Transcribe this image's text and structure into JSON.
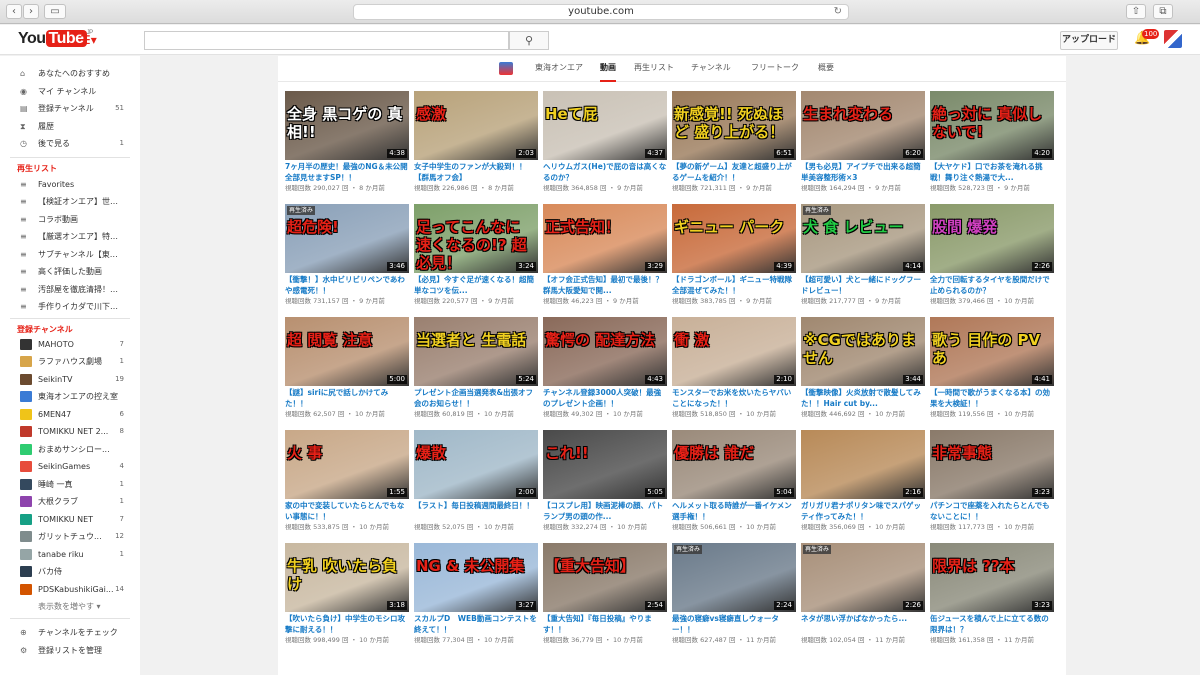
{
  "browser": {
    "url": "youtube.com"
  },
  "masthead": {
    "logo_you": "You",
    "logo_tube": "Tube",
    "logo_region": "JP",
    "upload_label": "アップロード",
    "notification_count": "100"
  },
  "sidebar": {
    "top_items": [
      {
        "icon": "home-icon",
        "label": "あなたへのおすすめ",
        "count": ""
      },
      {
        "icon": "user-icon",
        "label": "マイ チャンネル",
        "count": ""
      },
      {
        "icon": "subscriptions-icon",
        "label": "登録チャンネル",
        "count": "51"
      },
      {
        "icon": "history-icon",
        "label": "履歴",
        "count": ""
      },
      {
        "icon": "clock-icon",
        "label": "後で見る",
        "count": "1"
      }
    ],
    "playlists_heading": "再生リスト",
    "playlists": [
      {
        "label": "Favorites"
      },
      {
        "label": "【検証オンエア】世界..."
      },
      {
        "label": "コラボ動画"
      },
      {
        "label": "【厳選オンエア】特に..."
      },
      {
        "label": "サブチャンネル【東海..."
      },
      {
        "label": "高く評価した動画"
      },
      {
        "label": "汚部屋を徹底清掃！床..."
      },
      {
        "label": "手作りイカダで川下り！"
      }
    ],
    "subs_heading": "登録チャンネル",
    "subscriptions": [
      {
        "label": "MAHOTO",
        "count": "7",
        "color": "#333333"
      },
      {
        "label": "ラファハウス劇場",
        "count": "1",
        "color": "#d7a54a"
      },
      {
        "label": "SeikinTV",
        "count": "19",
        "color": "#6b4a2f"
      },
      {
        "label": "東海オンエアの控え室",
        "count": "",
        "color": "#3a7bd5"
      },
      {
        "label": "6MEN47",
        "count": "6",
        "color": "#f0c419"
      },
      {
        "label": "TOMIKKU NET 2...",
        "count": "8",
        "color": "#c0392b"
      },
      {
        "label": "おまめサンシロー...",
        "count": "",
        "color": "#2ecc71"
      },
      {
        "label": "SeikinGames",
        "count": "4",
        "color": "#e74c3c"
      },
      {
        "label": "睡崎 一真",
        "count": "1",
        "color": "#34495e"
      },
      {
        "label": "大根クラブ",
        "count": "1",
        "color": "#8e44ad"
      },
      {
        "label": "TOMIKKU NET",
        "count": "7",
        "color": "#16a085"
      },
      {
        "label": "ガリットチュウ...",
        "count": "12",
        "color": "#7f8c8d"
      },
      {
        "label": "tanabe riku",
        "count": "1",
        "color": "#95a5a6"
      },
      {
        "label": "バカ侍",
        "count": "",
        "color": "#2c3e50"
      },
      {
        "label": "PDSKabushikiGai...",
        "count": "14",
        "color": "#d35400"
      }
    ],
    "show_more": "表示数を増やす ▾",
    "bottom_items": [
      {
        "icon": "plus-circle-icon",
        "label": "チャンネルをチェック"
      },
      {
        "icon": "gear-icon",
        "label": "登録リストを管理"
      }
    ]
  },
  "channel": {
    "name": "東海オンエア",
    "tabs": [
      "動画",
      "再生リスト",
      "チャンネル",
      "フリートーク",
      "概要"
    ],
    "active_tab": "動画"
  },
  "videos": [
    {
      "thumb_text": "全身 黒コゲの 真相!!",
      "duration": "4:38",
      "title": "7ヶ月半の歴史！最強のNG＆未公開全部見せますSP！！",
      "meta": "視聴回数 290,027 回 ・ 8 か月前",
      "watched": "",
      "bg": "#6b5a4a",
      "accent": "#ffffff"
    },
    {
      "thumb_text": "感激",
      "duration": "2:03",
      "title": "女子中学生のファンが大殺到！！【群馬オフ会】",
      "meta": "視聴回数 226,986 回 ・ 8 か月前",
      "watched": "",
      "bg": "#b8a27a",
      "accent": "#e62117"
    },
    {
      "thumb_text": "Heて屁",
      "duration": "4:37",
      "title": "ヘリウムガス(He)で屁の音は高くなるのか？",
      "meta": "視聴回数 364,858 回 ・ 9 か月前",
      "watched": "",
      "bg": "#c9c1b5",
      "accent": "#f0d020"
    },
    {
      "thumb_text": "新感覚!! 死ぬほど 盛り上がる！",
      "duration": "6:51",
      "title": "【夢の新ゲーム】友達と超盛り上がるゲームを紹介！！",
      "meta": "視聴回数 721,311 回 ・ 9 か月前",
      "watched": "",
      "bg": "#9a7a5a",
      "accent": "#f0d020"
    },
    {
      "thumb_text": "生まれ変わる",
      "duration": "6:20",
      "title": "【男も必見】アイプチで出来る超簡単美容整形術×3",
      "meta": "視聴回数 164,294 回 ・ 9 か月前",
      "watched": "",
      "bg": "#a38870",
      "accent": "#e62117"
    },
    {
      "thumb_text": "絶っ対に 真似しないで!",
      "duration": "4:20",
      "title": "【大ヤケド】口でお茶を淹れる挑戦！舞り注ぐ熱湯で大...",
      "meta": "視聴回数 528,723 回 ・ 9 か月前",
      "watched": "",
      "bg": "#7a8a6a",
      "accent": "#e62117"
    },
    {
      "thumb_text": "超危険!",
      "duration": "3:46",
      "title": "【衝撃！】水中ビリビリペンであわや感電死！！",
      "meta": "視聴回数 731,157 回 ・ 9 か月前",
      "watched": "再生済み",
      "bg": "#8aa0b8",
      "accent": "#e62117"
    },
    {
      "thumb_text": "足ってこんなに 速くなるの!? 超必見！",
      "duration": "3:24",
      "title": "【必見】今すぐ足が速くなる！超簡単なコツを伝...",
      "meta": "視聴回数 220,577 回 ・ 9 か月前",
      "watched": "",
      "bg": "#7ea06a",
      "accent": "#e62117"
    },
    {
      "thumb_text": "正式告知！",
      "duration": "3:29",
      "title": "【オフ会正式告知】最初で最後！？群馬大阪愛知で開...",
      "meta": "視聴回数 46,223 回 ・ 9 か月前",
      "watched": "",
      "bg": "#d88a5a",
      "accent": "#e62117"
    },
    {
      "thumb_text": "ギニュー パーク",
      "duration": "4:39",
      "title": "【ドラゴンボール】ギニュー特戦隊全部混ぜてみた！！",
      "meta": "視聴回数 383,785 回 ・ 9 か月前",
      "watched": "",
      "bg": "#c86a3a",
      "accent": "#f0d020"
    },
    {
      "thumb_text": "犬 食 レビュー",
      "duration": "4:14",
      "title": "【超可愛い】犬と一緒にドッグフードレビュー！",
      "meta": "視聴回数 217,777 回 ・ 9 か月前",
      "watched": "再生済み",
      "bg": "#a89880",
      "accent": "#22cc44"
    },
    {
      "thumb_text": "股間 爆発",
      "duration": "2:26",
      "title": "全力で回転するタイヤを股間だけで止められるのか？",
      "meta": "視聴回数 379,466 回 ・ 10 か月前",
      "watched": "",
      "bg": "#8a9a6a",
      "accent": "#d040c0"
    },
    {
      "thumb_text": "超 閲覧 注意",
      "duration": "5:00",
      "title": "【謎】siriに尻で話しかけてみた！！",
      "meta": "視聴回数 62,507 回 ・ 10 か月前",
      "watched": "",
      "bg": "#b89070",
      "accent": "#e62117"
    },
    {
      "thumb_text": "当選者と 生電話",
      "duration": "5:24",
      "title": "プレゼント企画当選発表&出張オフ会のお知らせ！！",
      "meta": "視聴回数 60,819 回 ・ 10 か月前",
      "watched": "",
      "bg": "#9a8070",
      "accent": "#f0d020"
    },
    {
      "thumb_text": "驚愕の 配達方法",
      "duration": "4:43",
      "title": "チャンネル登録3000人突破！最強のプレゼント企画！！",
      "meta": "視聴回数 49,302 回 ・ 10 か月前",
      "watched": "",
      "bg": "#8a6a5a",
      "accent": "#e62117"
    },
    {
      "thumb_text": "衝 激",
      "duration": "2:10",
      "title": "モンスターでお米を炊いたらヤバいことになった！！",
      "meta": "視聴回数 518,850 回 ・ 10 か月前",
      "watched": "",
      "bg": "#c8b098",
      "accent": "#e62117"
    },
    {
      "thumb_text": "※CGではありません",
      "duration": "3:44",
      "title": "【衝撃映像】火炎放射で散髪してみた！！Hair cut by...",
      "meta": "視聴回数 446,692 回 ・ 10 か月前",
      "watched": "",
      "bg": "#a08870",
      "accent": "#f0d020"
    },
    {
      "thumb_text": "歌う 目作の PVあ",
      "duration": "4:41",
      "title": "【一時間で歌がうまくなる本】の効果を大検証！！",
      "meta": "視聴回数 119,556 回 ・ 10 か月前",
      "watched": "",
      "bg": "#b07858",
      "accent": "#f0d020"
    },
    {
      "thumb_text": "火 事",
      "duration": "1:55",
      "title": "家の中で変装していたらとんでもない事態に！！",
      "meta": "視聴回数 533,875 回 ・ 10 か月前",
      "watched": "",
      "bg": "#c8a888",
      "accent": "#e62117"
    },
    {
      "thumb_text": "爆散",
      "duration": "2:00",
      "title": "【ラスト】毎日投稿週間最終日！！",
      "meta": "視聴回数 52,075 回 ・ 10 か月前",
      "watched": "",
      "bg": "#a0b8c8",
      "accent": "#e62117"
    },
    {
      "thumb_text": "これ!!",
      "duration": "5:05",
      "title": "【コスプレ用】映画泥棒の顔、パトランプ男の頭の作...",
      "meta": "視聴回数 332,274 回 ・ 10 か月前",
      "watched": "",
      "bg": "#4a4a4a",
      "accent": "#e62117"
    },
    {
      "thumb_text": "優勝は 誰だ",
      "duration": "5:04",
      "title": "ヘルメット取る時誰が一番イケメン選手権！！",
      "meta": "視聴回数 506,661 回 ・ 10 か月前",
      "watched": "",
      "bg": "#9a8a7a",
      "accent": "#e62117"
    },
    {
      "thumb_text": "",
      "duration": "2:16",
      "title": "ガリガリ君ナポリタン味でスパゲッティ作ってみた！！",
      "meta": "視聴回数 356,069 回 ・ 10 か月前",
      "watched": "",
      "bg": "#b88a58",
      "accent": "#ffffff"
    },
    {
      "thumb_text": "非常事態",
      "duration": "3:23",
      "title": "パチンコで座薬を入れたらとんでもないことに！！",
      "meta": "視聴回数 117,773 回 ・ 10 か月前",
      "watched": "",
      "bg": "#8a7a6a",
      "accent": "#e62117"
    },
    {
      "thumb_text": "牛乳 吹いたら負け",
      "duration": "3:18",
      "title": "【吹いたら負け】中学生のモシロ攻撃に耐える！！",
      "meta": "視聴回数 998,499 回 ・ 10 か月前",
      "watched": "",
      "bg": "#c8b8a0",
      "accent": "#f0d020"
    },
    {
      "thumb_text": "NG & 未公開集",
      "duration": "3:27",
      "title": "スカルプD　WEB動画コンテストを終えて！！",
      "meta": "視聴回数 77,304 回 ・ 10 か月前",
      "watched": "",
      "bg": "#9ab8d8",
      "accent": "#e62117"
    },
    {
      "thumb_text": "【重大告知】",
      "duration": "2:54",
      "title": "【重大告知】『毎日投稿』やります！！",
      "meta": "視聴回数 36,779 回 ・ 10 か月前",
      "watched": "",
      "bg": "#8a7a6a",
      "accent": "#e62117"
    },
    {
      "thumb_text": "",
      "duration": "2:24",
      "title": "最強の寝癖vs寝癖直しウォーター！！",
      "meta": "視聴回数 627,487 回 ・ 11 か月前",
      "watched": "再生済み",
      "bg": "#6a7a8a",
      "accent": "#ffffff"
    },
    {
      "thumb_text": "",
      "duration": "2:26",
      "title": "ネタが思い浮かばなかったら...",
      "meta": "視聴回数 102,054 回 ・ 11 か月前",
      "watched": "再生済み",
      "bg": "#a8907a",
      "accent": "#ffffff"
    },
    {
      "thumb_text": "限界は ??本",
      "duration": "3:23",
      "title": "缶ジュースを積んで上に立てる数の限界は！？",
      "meta": "視聴回数 161,358 回 ・ 11 か月前",
      "watched": "",
      "bg": "#8a8a7a",
      "accent": "#e62117"
    }
  ]
}
